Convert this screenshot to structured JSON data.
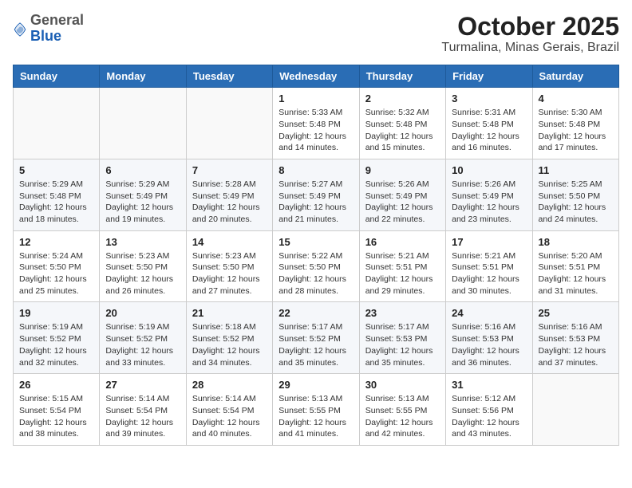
{
  "header": {
    "logo_general": "General",
    "logo_blue": "Blue",
    "title": "October 2025",
    "subtitle": "Turmalina, Minas Gerais, Brazil"
  },
  "weekdays": [
    "Sunday",
    "Monday",
    "Tuesday",
    "Wednesday",
    "Thursday",
    "Friday",
    "Saturday"
  ],
  "weeks": [
    [
      {
        "day": "",
        "info": ""
      },
      {
        "day": "",
        "info": ""
      },
      {
        "day": "",
        "info": ""
      },
      {
        "day": "1",
        "info": "Sunrise: 5:33 AM\nSunset: 5:48 PM\nDaylight: 12 hours\nand 14 minutes."
      },
      {
        "day": "2",
        "info": "Sunrise: 5:32 AM\nSunset: 5:48 PM\nDaylight: 12 hours\nand 15 minutes."
      },
      {
        "day": "3",
        "info": "Sunrise: 5:31 AM\nSunset: 5:48 PM\nDaylight: 12 hours\nand 16 minutes."
      },
      {
        "day": "4",
        "info": "Sunrise: 5:30 AM\nSunset: 5:48 PM\nDaylight: 12 hours\nand 17 minutes."
      }
    ],
    [
      {
        "day": "5",
        "info": "Sunrise: 5:29 AM\nSunset: 5:48 PM\nDaylight: 12 hours\nand 18 minutes."
      },
      {
        "day": "6",
        "info": "Sunrise: 5:29 AM\nSunset: 5:49 PM\nDaylight: 12 hours\nand 19 minutes."
      },
      {
        "day": "7",
        "info": "Sunrise: 5:28 AM\nSunset: 5:49 PM\nDaylight: 12 hours\nand 20 minutes."
      },
      {
        "day": "8",
        "info": "Sunrise: 5:27 AM\nSunset: 5:49 PM\nDaylight: 12 hours\nand 21 minutes."
      },
      {
        "day": "9",
        "info": "Sunrise: 5:26 AM\nSunset: 5:49 PM\nDaylight: 12 hours\nand 22 minutes."
      },
      {
        "day": "10",
        "info": "Sunrise: 5:26 AM\nSunset: 5:49 PM\nDaylight: 12 hours\nand 23 minutes."
      },
      {
        "day": "11",
        "info": "Sunrise: 5:25 AM\nSunset: 5:50 PM\nDaylight: 12 hours\nand 24 minutes."
      }
    ],
    [
      {
        "day": "12",
        "info": "Sunrise: 5:24 AM\nSunset: 5:50 PM\nDaylight: 12 hours\nand 25 minutes."
      },
      {
        "day": "13",
        "info": "Sunrise: 5:23 AM\nSunset: 5:50 PM\nDaylight: 12 hours\nand 26 minutes."
      },
      {
        "day": "14",
        "info": "Sunrise: 5:23 AM\nSunset: 5:50 PM\nDaylight: 12 hours\nand 27 minutes."
      },
      {
        "day": "15",
        "info": "Sunrise: 5:22 AM\nSunset: 5:50 PM\nDaylight: 12 hours\nand 28 minutes."
      },
      {
        "day": "16",
        "info": "Sunrise: 5:21 AM\nSunset: 5:51 PM\nDaylight: 12 hours\nand 29 minutes."
      },
      {
        "day": "17",
        "info": "Sunrise: 5:21 AM\nSunset: 5:51 PM\nDaylight: 12 hours\nand 30 minutes."
      },
      {
        "day": "18",
        "info": "Sunrise: 5:20 AM\nSunset: 5:51 PM\nDaylight: 12 hours\nand 31 minutes."
      }
    ],
    [
      {
        "day": "19",
        "info": "Sunrise: 5:19 AM\nSunset: 5:52 PM\nDaylight: 12 hours\nand 32 minutes."
      },
      {
        "day": "20",
        "info": "Sunrise: 5:19 AM\nSunset: 5:52 PM\nDaylight: 12 hours\nand 33 minutes."
      },
      {
        "day": "21",
        "info": "Sunrise: 5:18 AM\nSunset: 5:52 PM\nDaylight: 12 hours\nand 34 minutes."
      },
      {
        "day": "22",
        "info": "Sunrise: 5:17 AM\nSunset: 5:52 PM\nDaylight: 12 hours\nand 35 minutes."
      },
      {
        "day": "23",
        "info": "Sunrise: 5:17 AM\nSunset: 5:53 PM\nDaylight: 12 hours\nand 35 minutes."
      },
      {
        "day": "24",
        "info": "Sunrise: 5:16 AM\nSunset: 5:53 PM\nDaylight: 12 hours\nand 36 minutes."
      },
      {
        "day": "25",
        "info": "Sunrise: 5:16 AM\nSunset: 5:53 PM\nDaylight: 12 hours\nand 37 minutes."
      }
    ],
    [
      {
        "day": "26",
        "info": "Sunrise: 5:15 AM\nSunset: 5:54 PM\nDaylight: 12 hours\nand 38 minutes."
      },
      {
        "day": "27",
        "info": "Sunrise: 5:14 AM\nSunset: 5:54 PM\nDaylight: 12 hours\nand 39 minutes."
      },
      {
        "day": "28",
        "info": "Sunrise: 5:14 AM\nSunset: 5:54 PM\nDaylight: 12 hours\nand 40 minutes."
      },
      {
        "day": "29",
        "info": "Sunrise: 5:13 AM\nSunset: 5:55 PM\nDaylight: 12 hours\nand 41 minutes."
      },
      {
        "day": "30",
        "info": "Sunrise: 5:13 AM\nSunset: 5:55 PM\nDaylight: 12 hours\nand 42 minutes."
      },
      {
        "day": "31",
        "info": "Sunrise: 5:12 AM\nSunset: 5:56 PM\nDaylight: 12 hours\nand 43 minutes."
      },
      {
        "day": "",
        "info": ""
      }
    ]
  ]
}
